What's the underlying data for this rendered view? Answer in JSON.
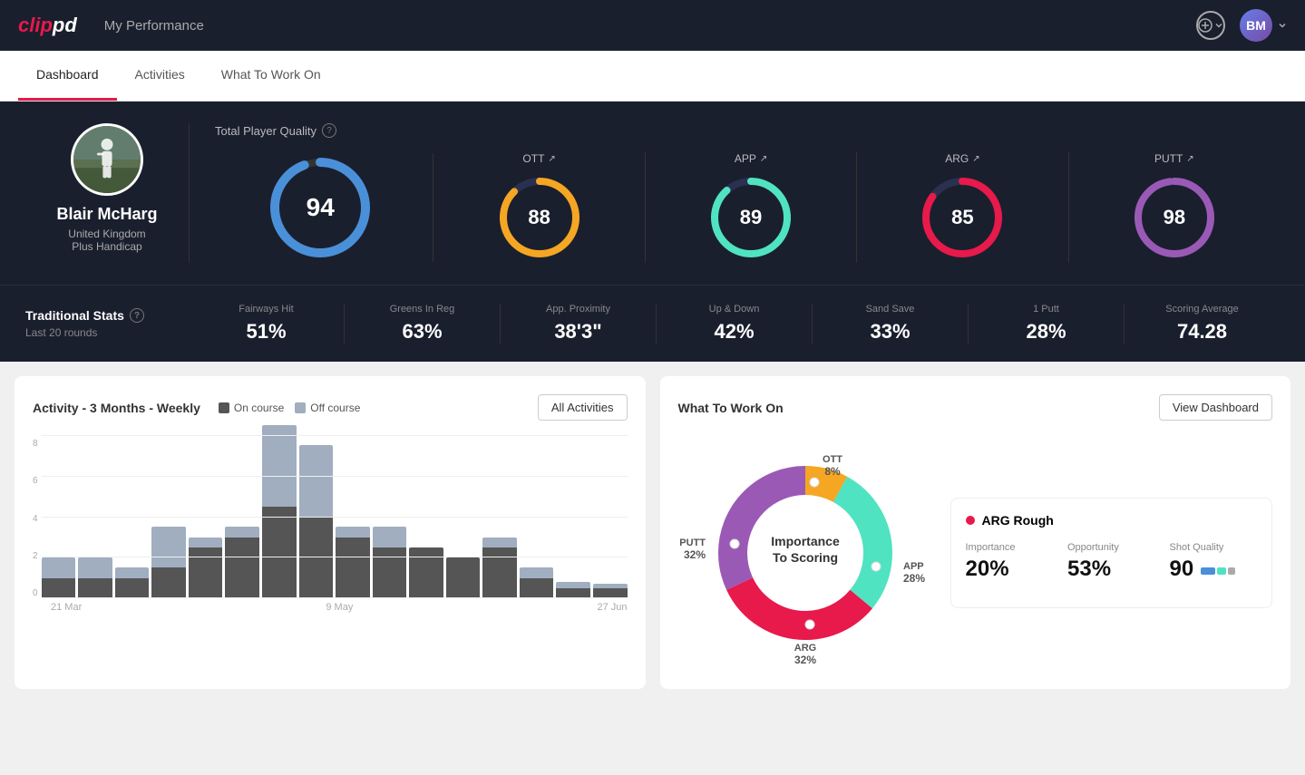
{
  "app": {
    "logo_text": "clippd",
    "header_title": "My Performance"
  },
  "tabs": [
    {
      "label": "Dashboard",
      "active": true
    },
    {
      "label": "Activities",
      "active": false
    },
    {
      "label": "What To Work On",
      "active": false
    }
  ],
  "player": {
    "name": "Blair McHarg",
    "country": "United Kingdom",
    "handicap": "Plus Handicap"
  },
  "quality": {
    "title": "Total Player Quality",
    "main_score": 94,
    "scores": [
      {
        "label": "OTT",
        "value": 88,
        "color": "#f5a623"
      },
      {
        "label": "APP",
        "value": 89,
        "color": "#50e3c2"
      },
      {
        "label": "ARG",
        "value": 85,
        "color": "#e8194b"
      },
      {
        "label": "PUTT",
        "value": 98,
        "color": "#9b59b6"
      }
    ]
  },
  "trad_stats": {
    "title": "Traditional Stats",
    "subtitle": "Last 20 rounds",
    "items": [
      {
        "label": "Fairways Hit",
        "value": "51%"
      },
      {
        "label": "Greens In Reg",
        "value": "63%"
      },
      {
        "label": "App. Proximity",
        "value": "38'3\""
      },
      {
        "label": "Up & Down",
        "value": "42%"
      },
      {
        "label": "Sand Save",
        "value": "33%"
      },
      {
        "label": "1 Putt",
        "value": "28%"
      },
      {
        "label": "Scoring Average",
        "value": "74.28"
      }
    ]
  },
  "activity_chart": {
    "title": "Activity - 3 Months - Weekly",
    "legend": [
      {
        "label": "On course",
        "color": "#555"
      },
      {
        "label": "Off course",
        "color": "#a0aec0"
      }
    ],
    "all_activities_label": "All Activities",
    "y_labels": [
      "8",
      "6",
      "4",
      "2",
      "0"
    ],
    "x_labels": [
      "21 Mar",
      "9 May",
      "27 Jun"
    ],
    "bars": [
      {
        "on": 1,
        "off": 1
      },
      {
        "on": 1,
        "off": 1
      },
      {
        "on": 1,
        "off": 0.5
      },
      {
        "on": 1.5,
        "off": 2
      },
      {
        "on": 2.5,
        "off": 0.5
      },
      {
        "on": 3,
        "off": 0.5
      },
      {
        "on": 4.5,
        "off": 4
      },
      {
        "on": 4,
        "off": 3.5
      },
      {
        "on": 3,
        "off": 0.5
      },
      {
        "on": 2.5,
        "off": 1
      },
      {
        "on": 2.5,
        "off": 0
      },
      {
        "on": 2,
        "off": 0
      },
      {
        "on": 2.5,
        "off": 0.5
      },
      {
        "on": 1,
        "off": 0.5
      },
      {
        "on": 0.5,
        "off": 0.3
      },
      {
        "on": 0.5,
        "off": 0.2
      }
    ]
  },
  "what_to_work_on": {
    "title": "What To Work On",
    "view_dashboard_label": "View Dashboard",
    "donut_center": "Importance\nTo Scoring",
    "segments": [
      {
        "label": "OTT",
        "pct": "8%",
        "color": "#f5a623"
      },
      {
        "label": "APP",
        "pct": "28%",
        "color": "#50e3c2"
      },
      {
        "label": "ARG",
        "pct": "32%",
        "color": "#e8194b"
      },
      {
        "label": "PUTT",
        "pct": "32%",
        "color": "#9b59b6"
      }
    ],
    "card": {
      "title": "ARG Rough",
      "dot_color": "#e8194b",
      "metrics": [
        {
          "label": "Importance",
          "value": "20%"
        },
        {
          "label": "Opportunity",
          "value": "53%"
        },
        {
          "label": "Shot Quality",
          "value": "90"
        }
      ]
    }
  }
}
